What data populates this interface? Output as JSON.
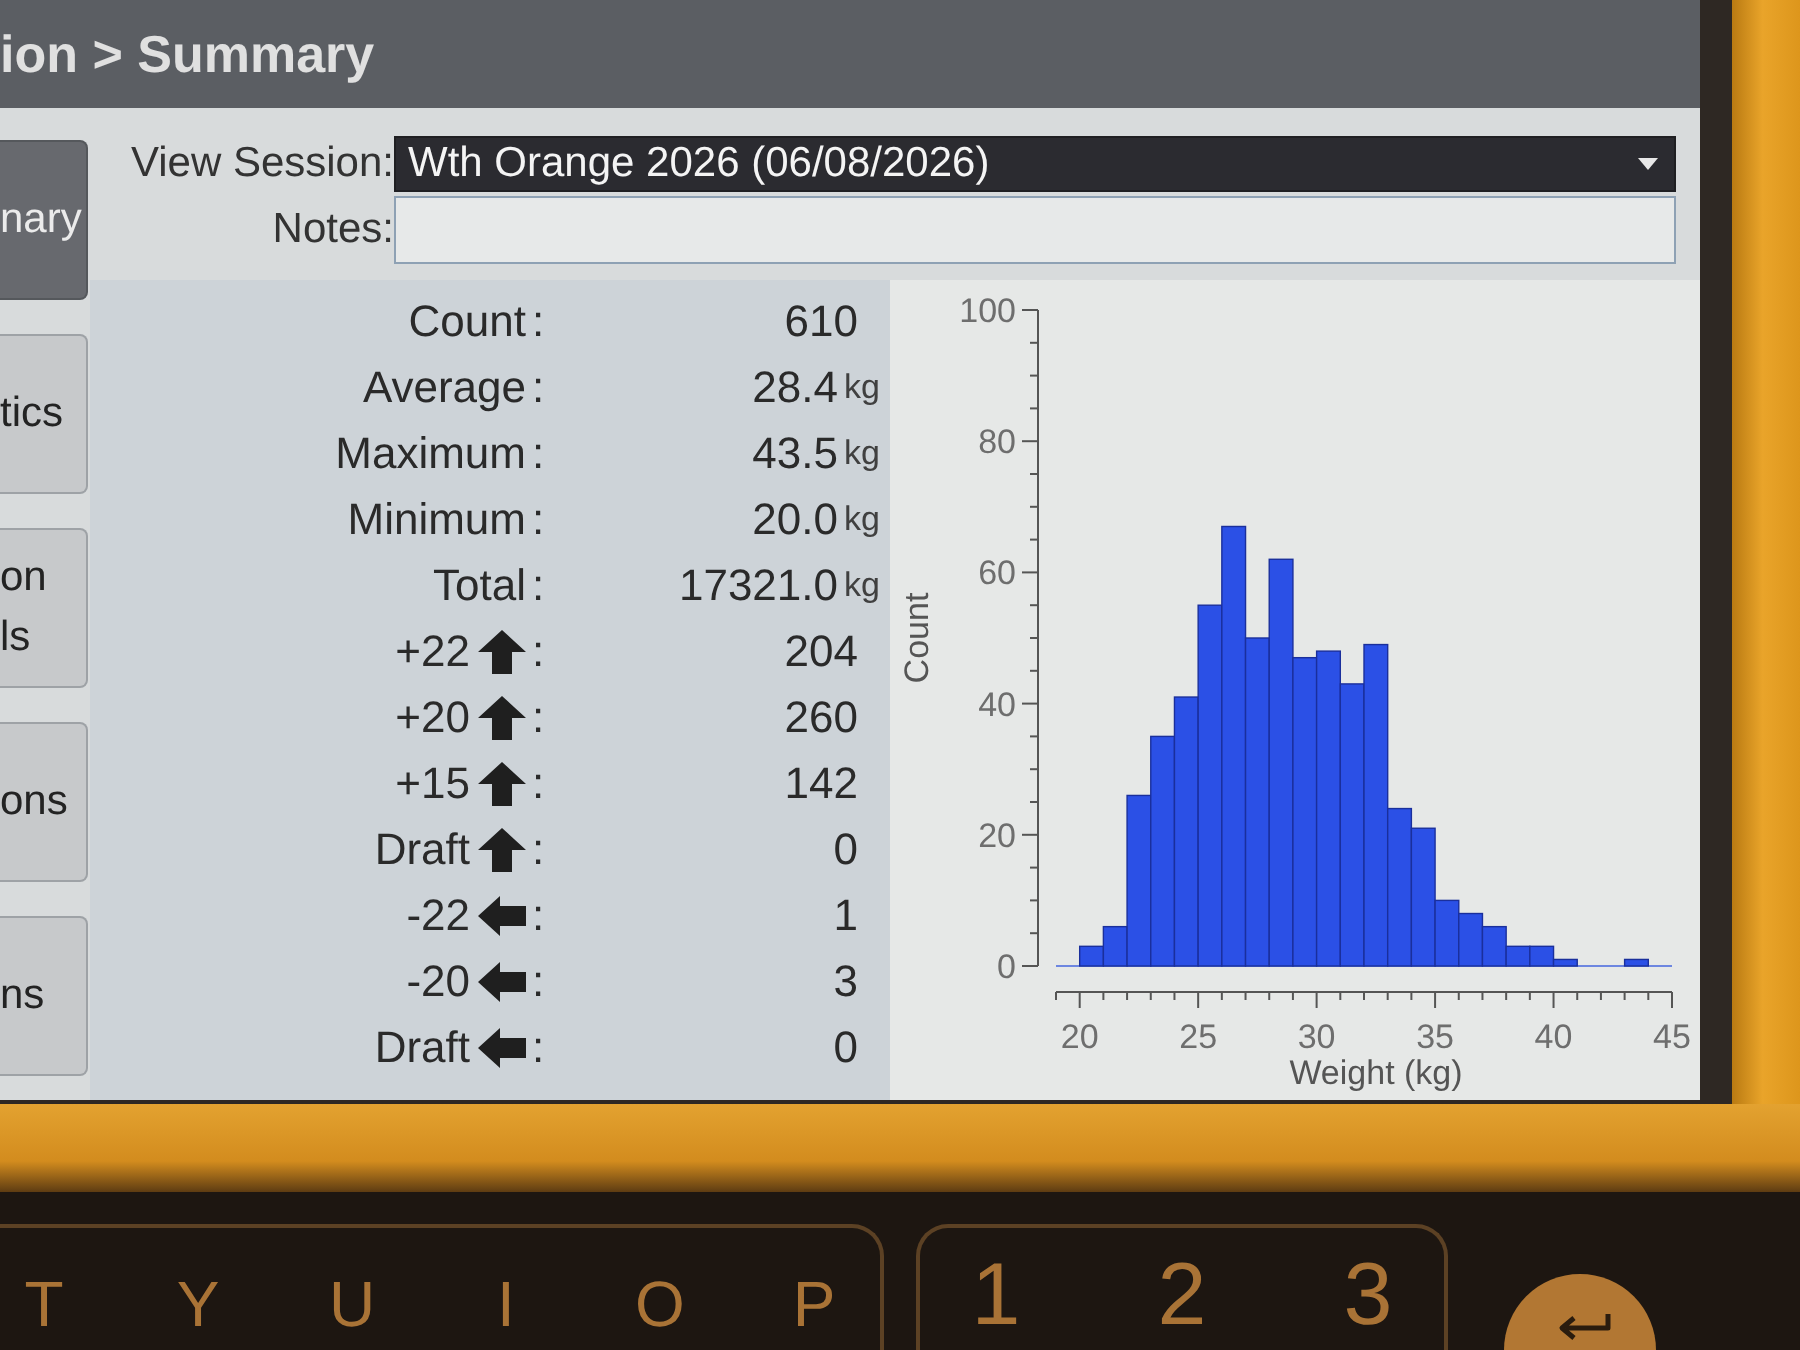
{
  "title_bar": {
    "text": "ion > Summary"
  },
  "sidebar": {
    "items": [
      {
        "label": "nary",
        "selected": true
      },
      {
        "label": "tics",
        "selected": false
      },
      {
        "label": "on ls",
        "selected": false
      },
      {
        "label": "ons",
        "selected": false
      },
      {
        "label": "ns",
        "selected": false
      }
    ]
  },
  "session": {
    "label": "View Session:",
    "value": "Wth Orange 2026 (06/08/2026)"
  },
  "notes": {
    "label": "Notes:"
  },
  "stats": [
    {
      "kind": "plain",
      "label": "Count",
      "sep": ":",
      "value": "610"
    },
    {
      "kind": "plain",
      "label": "Average",
      "sep": ":",
      "value": "28.4",
      "unit": "kg"
    },
    {
      "kind": "plain",
      "label": "Maximum",
      "sep": ":",
      "value": "43.5",
      "unit": "kg"
    },
    {
      "kind": "plain",
      "label": "Minimum",
      "sep": ":",
      "value": "20.0",
      "unit": "kg"
    },
    {
      "kind": "plain",
      "label": "Total",
      "sep": ":",
      "value": "17321.0",
      "unit": "kg"
    },
    {
      "kind": "arrow_up",
      "label": "+22",
      "sep": ":",
      "value": "204"
    },
    {
      "kind": "arrow_up",
      "label": "+20",
      "sep": ":",
      "value": "260"
    },
    {
      "kind": "arrow_up",
      "label": "+15",
      "sep": ":",
      "value": "142"
    },
    {
      "kind": "arrow_up",
      "label": "Draft",
      "sep": ":",
      "value": "0"
    },
    {
      "kind": "arrow_left",
      "label": "-22",
      "sep": ":",
      "value": "1"
    },
    {
      "kind": "arrow_left",
      "label": "-20",
      "sep": ":",
      "value": "3"
    },
    {
      "kind": "arrow_left",
      "label": "Draft",
      "sep": ":",
      "value": "0"
    }
  ],
  "chart": {
    "chart_data": {
      "type": "bar",
      "xlabel": "Weight (kg)",
      "ylabel": "Count",
      "x": [
        20.5,
        21.5,
        22.5,
        23.5,
        24.5,
        25.5,
        26.5,
        27.5,
        28.5,
        29.5,
        30.5,
        31.5,
        32.5,
        33.5,
        34.5,
        35.5,
        36.5,
        37.5,
        38.5,
        39.5,
        40.5,
        43.5
      ],
      "values": [
        3,
        6,
        26,
        35,
        41,
        55,
        67,
        50,
        62,
        47,
        48,
        43,
        49,
        24,
        21,
        10,
        8,
        6,
        3,
        3,
        1,
        1
      ],
      "xlim": [
        19,
        45
      ],
      "ylim": [
        0,
        100
      ],
      "xticks": [
        20,
        25,
        30,
        35,
        40,
        45
      ],
      "yticks": [
        0,
        20,
        40,
        60,
        80,
        100
      ]
    }
  },
  "keypad": {
    "groups": [
      {
        "keys": [
          "T",
          "Y",
          "U",
          "I",
          "O",
          "P"
        ]
      },
      {
        "keys": [
          "1",
          "2",
          "3"
        ]
      }
    ]
  }
}
